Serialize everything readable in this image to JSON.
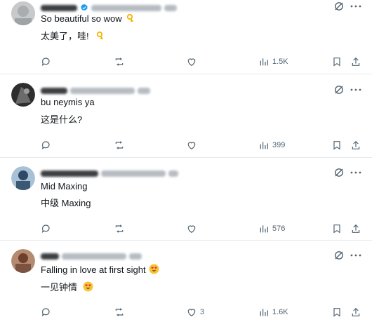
{
  "replies": [
    {
      "line1": "So beautiful so wow",
      "line2": "太美了，哇!",
      "line1_emoji": "ok-hand-icon",
      "line2_emoji": "ok-hand-icon",
      "likes": "",
      "views": "1.5K",
      "verified": true,
      "avatar_color": "#b5b8bb"
    },
    {
      "line1": "bu neymis ya",
      "line2": "这是什么?",
      "likes": "",
      "views": "399",
      "verified": false,
      "avatar_color": "#3a3a3a"
    },
    {
      "line1": "Mid Maxing",
      "line2": "中级 Maxing",
      "likes": "",
      "views": "576",
      "verified": false,
      "avatar_color": "#6f8aa8"
    },
    {
      "line1": "Falling in love at first sight",
      "line2": "一见钟情",
      "line1_emoji": "heart-eyes-icon",
      "line2_emoji": "heart-eyes-icon",
      "likes": "3",
      "views": "1.6K",
      "verified": false,
      "avatar_color": "#9a6a55"
    }
  ],
  "colors": {
    "text": "#0f1419",
    "muted": "#536471",
    "divider": "#e7e9ea",
    "verified": "#1d9bf0"
  }
}
